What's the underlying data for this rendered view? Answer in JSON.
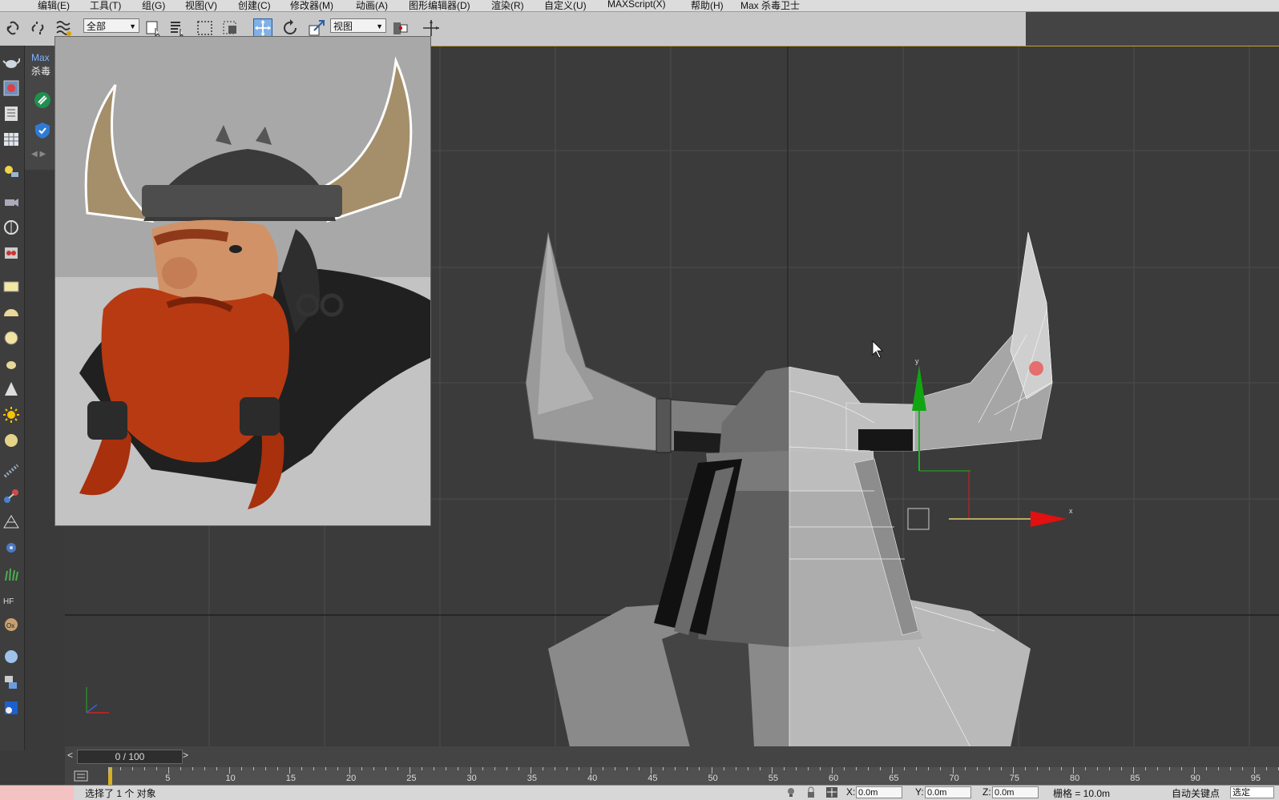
{
  "menu": [
    {
      "label": "编辑(E)"
    },
    {
      "label": "工具(T)"
    },
    {
      "label": "组(G)"
    },
    {
      "label": "视图(V)"
    },
    {
      "label": "创建(C)"
    },
    {
      "label": "修改器(M)"
    },
    {
      "label": "动画(A)"
    },
    {
      "label": "图形编辑器(D)"
    },
    {
      "label": "渲染(R)"
    },
    {
      "label": "自定义(U)"
    },
    {
      "label": "MAXScript(X)"
    },
    {
      "label": "帮助(H)"
    },
    {
      "label": "Max 杀毒卫士"
    }
  ],
  "toolbar": {
    "selection_filter": "全部",
    "reference_coord": "视图"
  },
  "cmdpanel": {
    "title_line1": "Max",
    "title_line2": "杀毒"
  },
  "viewport": {
    "gizmo_x_label": "x",
    "gizmo_y_label": "y",
    "model_name": "viking helmet mesh",
    "accent": "#c9a227"
  },
  "timeline": {
    "frame_counter": "0 / 100",
    "prev_arrow": "<",
    "next_arrow": ">",
    "ticks": [
      "5",
      "10",
      "15",
      "20",
      "25",
      "30",
      "35",
      "40",
      "45",
      "50",
      "55",
      "60",
      "65",
      "70",
      "75",
      "80",
      "85",
      "90",
      "95"
    ]
  },
  "status": {
    "message": "选择了 1 个 对象",
    "x_label": "X:",
    "x_value": "0.0m",
    "y_label": "Y:",
    "y_value": "0.0m",
    "z_label": "Z:",
    "z_value": "0.0m",
    "grid": "栅格 = 10.0m",
    "autokey": "自动关键点",
    "selected": "选定"
  }
}
